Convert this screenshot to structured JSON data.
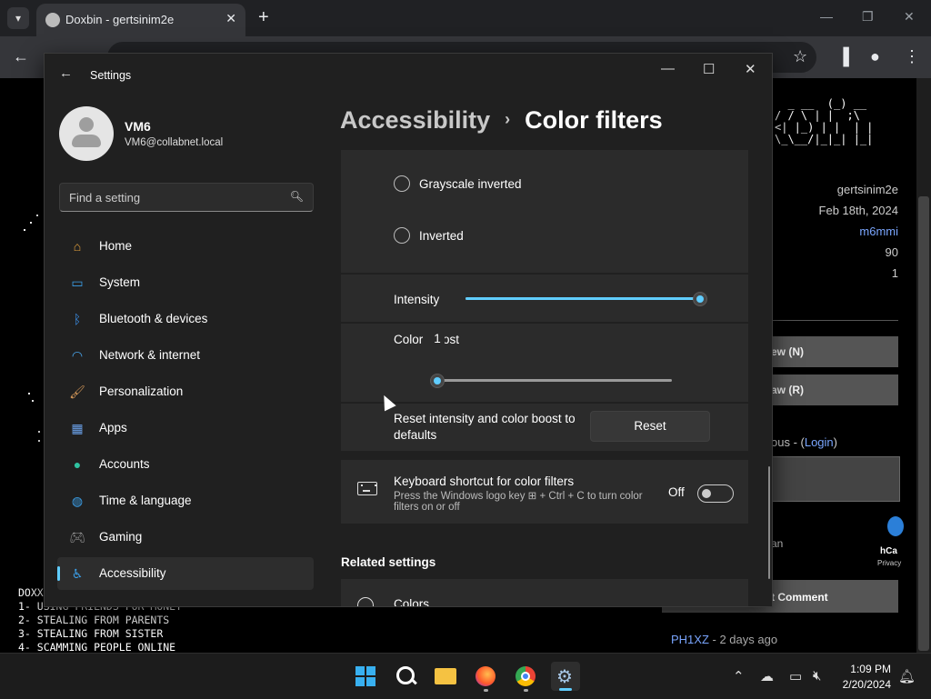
{
  "browser": {
    "tab_title": "Doxbin - gertsinim2e",
    "tab_close": "✕",
    "new_tab": "+",
    "toolbar_icons": {
      "back": "←",
      "star": "☆",
      "menu": "⋮"
    }
  },
  "webpage": {
    "ascii_art": "  _ __  (_) __\n/ / \\ | |  ;\\\n<| |_) | |  | |\n\\_\\__/|_|_| |_|",
    "author": "gertsinim2e",
    "date": "Feb 18th, 2024",
    "user_link": "m6mmi",
    "stat1": "90",
    "stat2": "1",
    "btn1": "ew (N)",
    "btn2": "aw (R)",
    "anon_prefix": "ous - (",
    "login_link": "Login",
    "anon_suffix": ")",
    "captcha_text": "an",
    "hcaptcha_label": "hCa",
    "hcaptcha_privacy": "Privacy",
    "comment_btn": "t Comment",
    "comment_user": "PH1XZ",
    "comment_time": " - 2 days ago",
    "doxx_heading": "DOXX",
    "doxx_items": [
      "1- USING FRIENDS FOR MONEY",
      "2- STEALING FROM PARENTS",
      "3- STEALING FROM SISTER",
      "4- SCAMMING PEOPLE ONLINE"
    ]
  },
  "settings": {
    "title": "Settings",
    "user": {
      "name": "VM6",
      "email": "VM6@collabnet.local"
    },
    "search_placeholder": "Find a setting",
    "nav": [
      {
        "label": "Home",
        "icon": "home-icon",
        "color": "#e8a33d"
      },
      {
        "label": "System",
        "icon": "system-icon",
        "color": "#3b9fe8"
      },
      {
        "label": "Bluetooth & devices",
        "icon": "bluetooth-icon",
        "color": "#3b8fe8"
      },
      {
        "label": "Network & internet",
        "icon": "wifi-icon",
        "color": "#4aa8f0"
      },
      {
        "label": "Personalization",
        "icon": "brush-icon",
        "color": "#d89a5a"
      },
      {
        "label": "Apps",
        "icon": "apps-icon",
        "color": "#6aa0e8"
      },
      {
        "label": "Accounts",
        "icon": "accounts-icon",
        "color": "#2fc2a0"
      },
      {
        "label": "Time & language",
        "icon": "globe-clock-icon",
        "color": "#3b9fe8"
      },
      {
        "label": "Gaming",
        "icon": "gamepad-icon",
        "color": "#9a9a9a"
      },
      {
        "label": "Accessibility",
        "icon": "accessibility-icon",
        "color": "#3b9fe8"
      }
    ],
    "selected_nav": "Accessibility",
    "breadcrumb": {
      "parent": "Accessibility",
      "separator": "›",
      "current": "Color filters"
    },
    "radio_options": [
      {
        "label": "Grayscale inverted",
        "selected": false
      },
      {
        "label": "Inverted",
        "selected": false
      }
    ],
    "intensity": {
      "label": "Intensity",
      "value_fraction": 1.0
    },
    "color_boost": {
      "label_start": "Color ",
      "label_end": "ost",
      "value_tooltip": "1",
      "value_fraction": 0.0
    },
    "reset": {
      "label": "Reset intensity and color boost to defaults",
      "button": "Reset"
    },
    "keyboard_shortcut": {
      "title": "Keyboard shortcut for color filters",
      "description": "Press the Windows logo key ⊞ + Ctrl + C to turn color filters on or off",
      "state_label": "Off",
      "on": false
    },
    "related_settings_title": "Related settings",
    "related_items": [
      {
        "label": "Colors"
      }
    ],
    "accent_color": "#60cdff"
  },
  "taskbar": {
    "time": "1:09 PM",
    "date": "2/20/2024",
    "apps": [
      "start-icon",
      "search-icon",
      "file-explorer-icon",
      "firefox-icon",
      "chrome-icon",
      "settings-icon"
    ],
    "tray_icons": [
      "chevron-up-icon",
      "cloud-icon",
      "network-icon",
      "volume-icon",
      "notification-icon"
    ]
  }
}
